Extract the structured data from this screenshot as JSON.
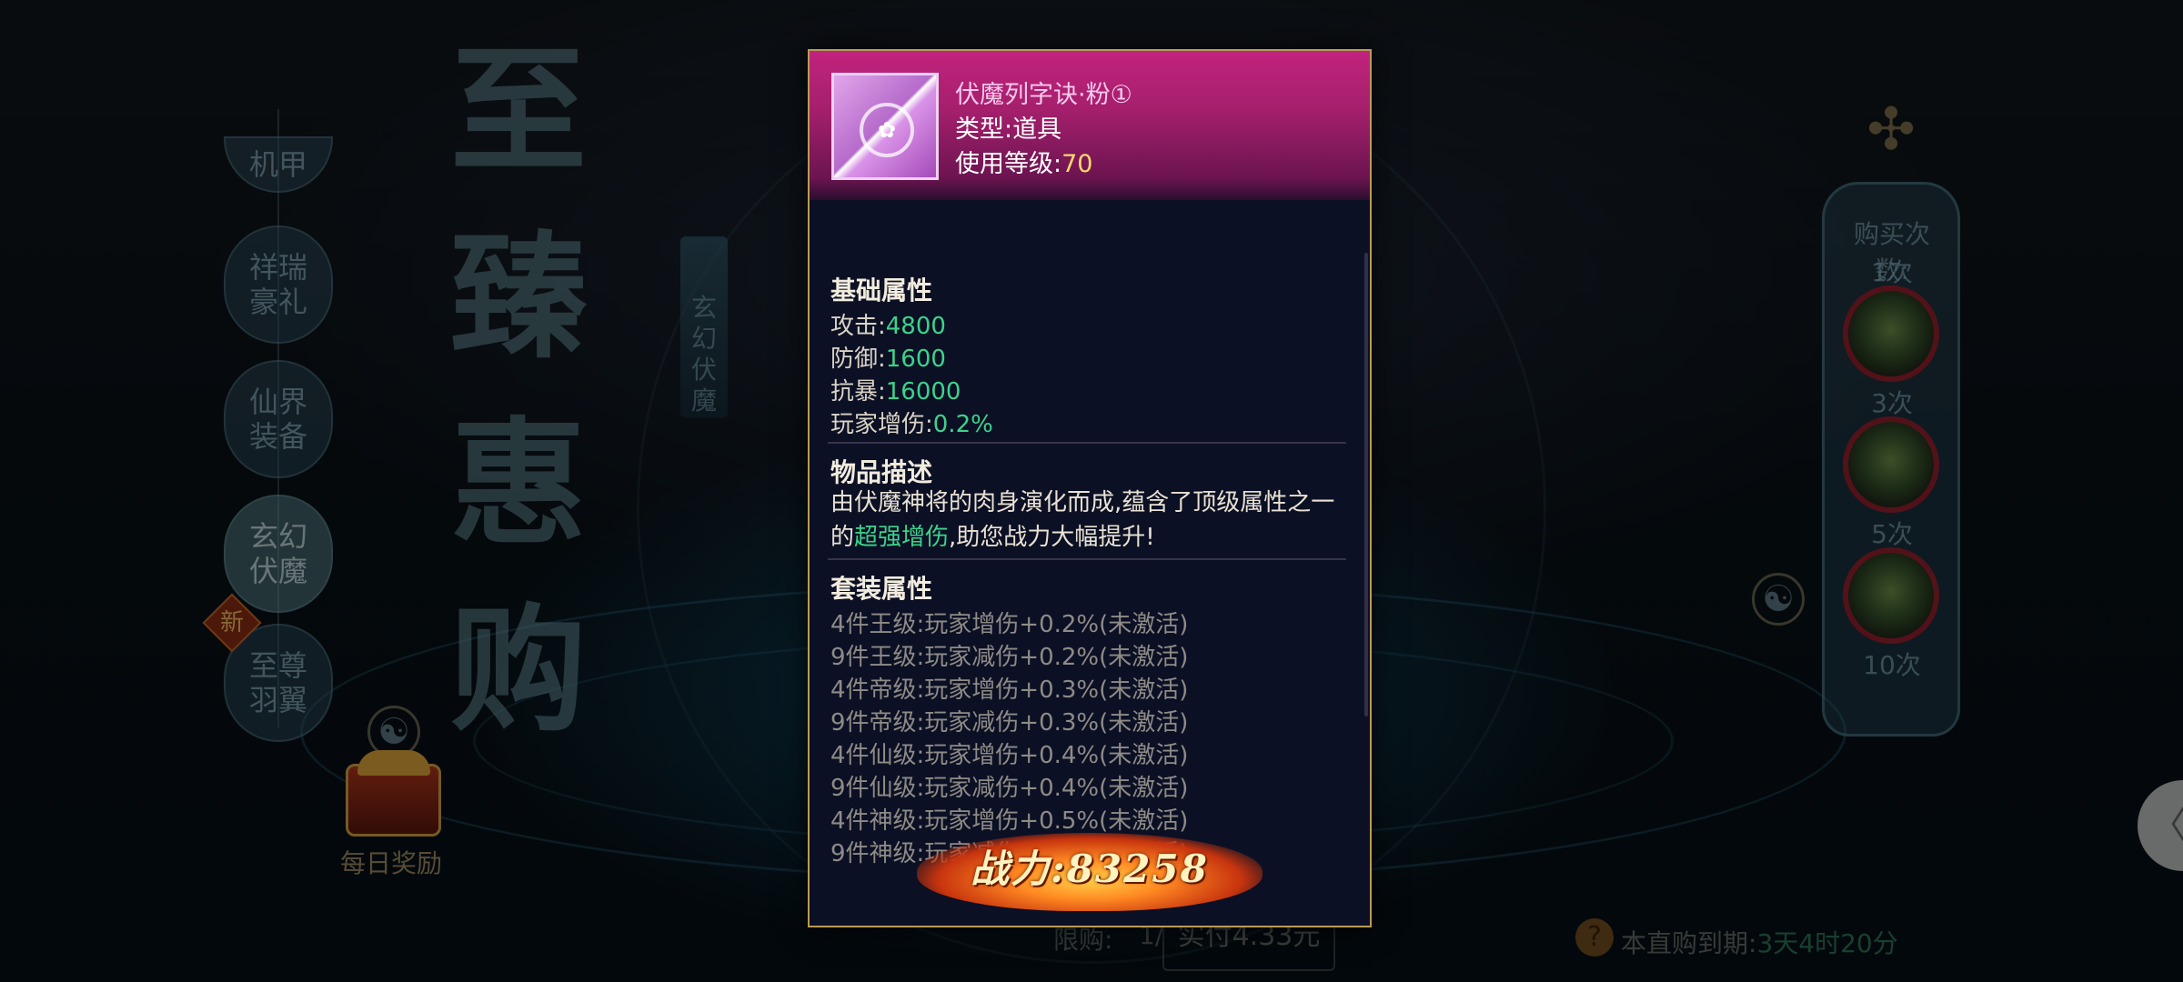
{
  "background": {
    "event_title": "至臻惠购",
    "side_tabs": [
      "机甲",
      "祥瑞豪礼",
      "仙界装备",
      "玄幻伏魔",
      "至尊羽翼"
    ],
    "new_badge": "新",
    "vertical_ribbon": "玄幻伏魔",
    "daily_reward": "每日奖励",
    "buy_panel": {
      "title": "购买次数:",
      "counts": [
        "1次",
        "3次",
        "5次",
        "10次"
      ]
    },
    "limit_label": "限购:",
    "limit_value": "1/",
    "price_button": "实付4.33元",
    "expire_label": "本直购到期:",
    "expire_value": "3天4时20分",
    "help_icon_text": "?",
    "edge_arrow": "〈"
  },
  "tooltip": {
    "item_name": "伏魔列字诀·粉①",
    "type_label": "类型:",
    "type_value": "道具",
    "level_label": "使用等级:",
    "level_value": "70",
    "base_title": "基础属性",
    "base_attrs": [
      {
        "label": "攻击:",
        "value": "4800"
      },
      {
        "label": "防御:",
        "value": "1600"
      },
      {
        "label": "抗暴:",
        "value": "16000"
      },
      {
        "label": "玩家增伤:",
        "value": "0.2%"
      }
    ],
    "desc_title": "物品描述",
    "desc_prefix": "由伏魔神将的肉身演化而成,蕴含了顶级属性之一的",
    "desc_highlight": "超强增伤",
    "desc_suffix": ",助您战力大幅提升!",
    "set_title": "套装属性",
    "set_lines": [
      "4件王级:玩家增伤+0.2%(未激活)",
      "9件王级:玩家减伤+0.2%(未激活)",
      "4件帝级:玩家增伤+0.3%(未激活)",
      "9件帝级:玩家减伤+0.3%(未激活)",
      "4件仙级:玩家增伤+0.4%(未激活)",
      "9件仙级:玩家减伤+0.4%(未激活)",
      "4件神级:玩家增伤+0.5%(未激活)",
      "9件神级:玩家减伤+0.5%(未激活)"
    ],
    "power_label": "战力:",
    "power_value": "83258"
  },
  "colors": {
    "header_pink": "#c2237e",
    "value_green": "#3bd38c",
    "level_gold": "#ffd86b",
    "inactive_gray": "#8e8b87",
    "frame_gold": "#b89b55"
  }
}
